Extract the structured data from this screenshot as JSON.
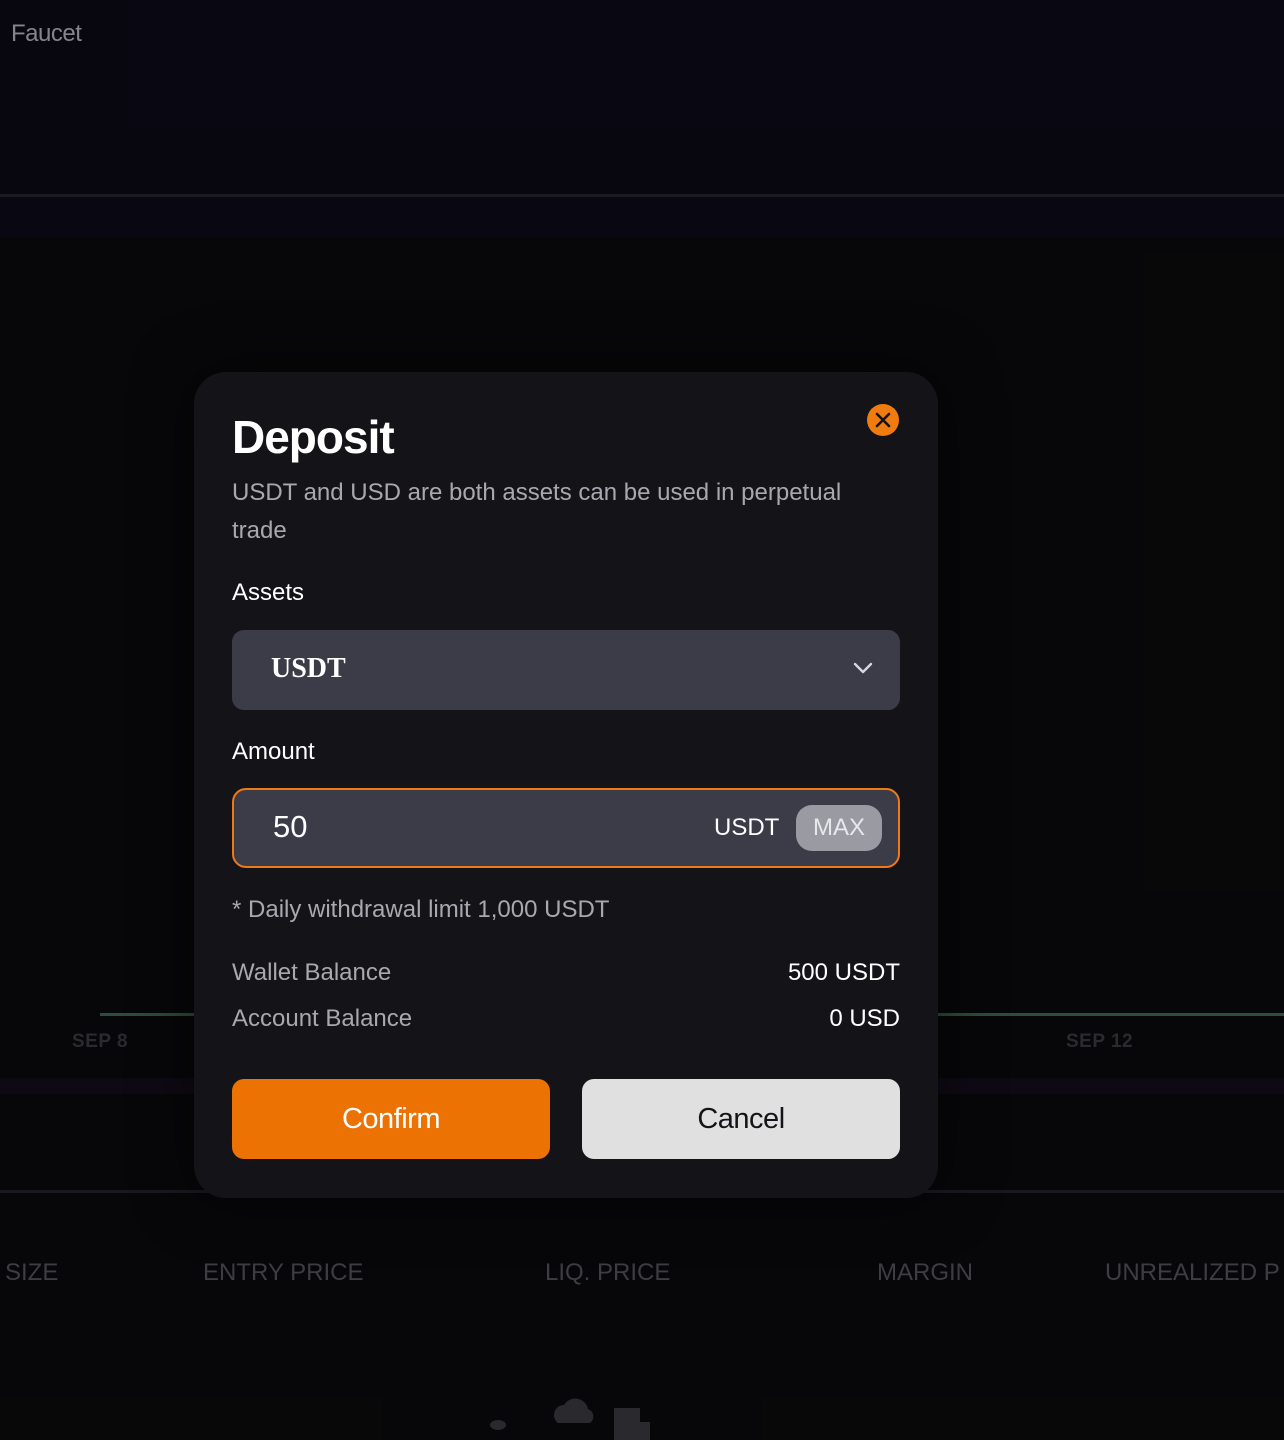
{
  "background": {
    "faucet_label": "Faucet",
    "chart_dates": [
      "SEP 8",
      "SEP 12"
    ],
    "table_headers": [
      "SIZE",
      "ENTRY PRICE",
      "LIQ. PRICE",
      "MARGIN",
      "UNREALIZED P"
    ]
  },
  "modal": {
    "title": "Deposit",
    "description": "USDT and USD are both assets can be used in perpetual trade",
    "assets_label": "Assets",
    "selected_asset": "USDT",
    "amount_label": "Amount",
    "amount_value": "50",
    "amount_unit": "USDT",
    "max_label": "MAX",
    "limit_note": "* Daily withdrawal limit 1,000 USDT",
    "wallet_balance_label": "Wallet Balance",
    "wallet_balance_value": "500 USDT",
    "account_balance_label": "Account Balance",
    "account_balance_value": "0 USD",
    "confirm_label": "Confirm",
    "cancel_label": "Cancel"
  },
  "icons": {
    "close": "close-icon",
    "dropdown": "chevron-down-icon"
  },
  "colors": {
    "accent": "#ec7203",
    "modal_bg": "#141418",
    "input_bg": "#3c3b48"
  }
}
